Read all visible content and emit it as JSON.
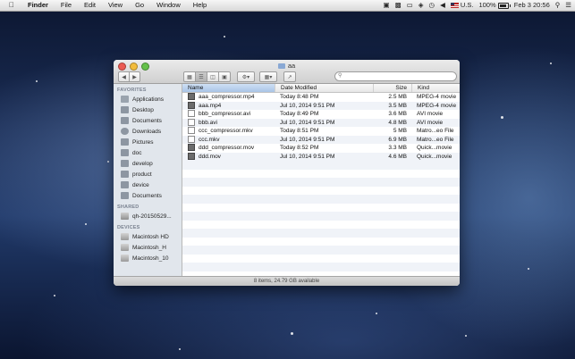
{
  "menubar": {
    "app_name": "Finder",
    "menus": [
      "File",
      "Edit",
      "View",
      "Go",
      "Window",
      "Help"
    ],
    "input_source": "U.S.",
    "battery": "100%",
    "clock": "Feb 3  20:56"
  },
  "window": {
    "title": "aa",
    "search_placeholder": ""
  },
  "sidebar": {
    "favorites_header": "FAVORITES",
    "favorites": [
      "Applications",
      "Desktop",
      "Documents",
      "Downloads",
      "Pictures",
      "doc",
      "develop",
      "product",
      "device",
      "Documents"
    ],
    "shared_header": "SHARED",
    "shared": [
      "qh-20150529..."
    ],
    "devices_header": "DEVICES",
    "devices": [
      "Macintosh HD",
      "Macintosh_H",
      "Macintosh_10"
    ]
  },
  "columns": {
    "name": "Name",
    "date": "Date Modified",
    "size": "Size",
    "kind": "Kind"
  },
  "files": [
    {
      "name": "aaa_compressor.mp4",
      "date": "Today 8:48 PM",
      "size": "2.5 MB",
      "kind": "MPEG-4 movie",
      "icon": "video-icon"
    },
    {
      "name": "aaa.mp4",
      "date": "Jul 10, 2014 9:51 PM",
      "size": "3.5 MB",
      "kind": "MPEG-4 movie",
      "icon": "video-icon"
    },
    {
      "name": "bbb_compressor.avi",
      "date": "Today 8:49 PM",
      "size": "3.6 MB",
      "kind": "AVI movie",
      "icon": "document-icon"
    },
    {
      "name": "bbb.avi",
      "date": "Jul 10, 2014 9:51 PM",
      "size": "4.8 MB",
      "kind": "AVI movie",
      "icon": "document-icon"
    },
    {
      "name": "ccc_compressor.mkv",
      "date": "Today 8:51 PM",
      "size": "5 MB",
      "kind": "Matro...eo File",
      "icon": "document-icon"
    },
    {
      "name": "ccc.mkv",
      "date": "Jul 10, 2014 9:51 PM",
      "size": "6.9 MB",
      "kind": "Matro...eo File",
      "icon": "document-icon"
    },
    {
      "name": "ddd_compressor.mov",
      "date": "Today 8:52 PM",
      "size": "3.3 MB",
      "kind": "Quick...movie",
      "icon": "video-icon"
    },
    {
      "name": "ddd.mov",
      "date": "Jul 10, 2014 9:51 PM",
      "size": "4.6 MB",
      "kind": "Quick...movie",
      "icon": "video-icon"
    }
  ],
  "status": "8 items, 24.79 GB available"
}
